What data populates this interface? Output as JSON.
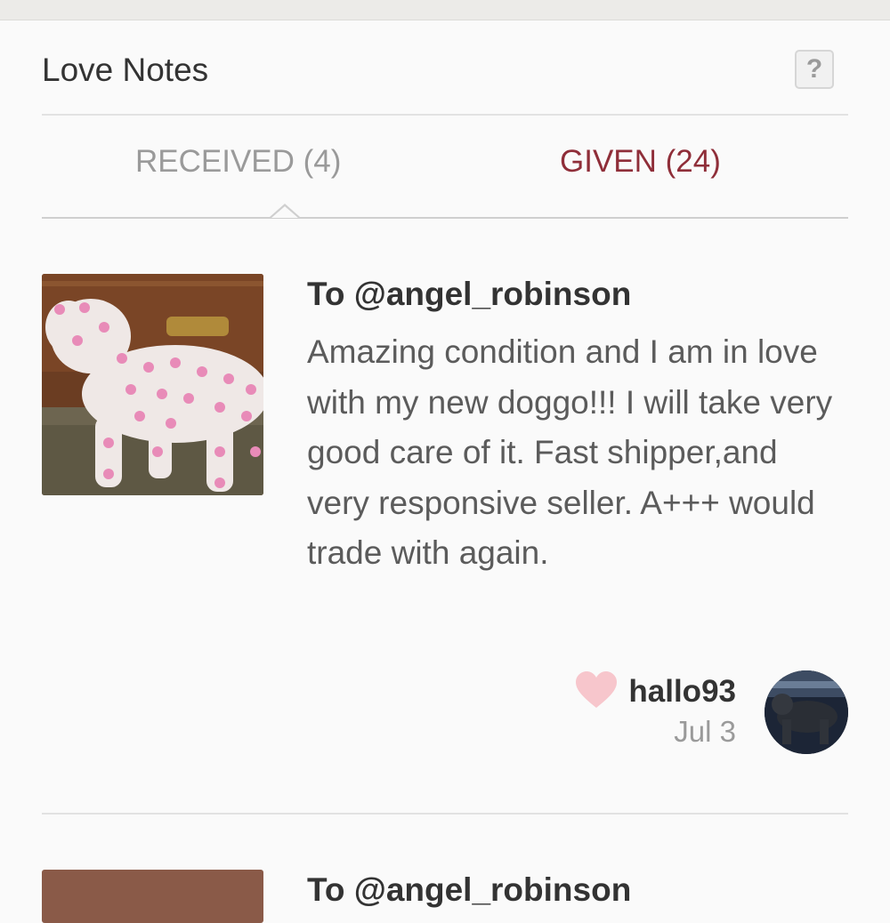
{
  "header": {
    "title": "Love Notes",
    "help_label": "?"
  },
  "tabs": [
    {
      "label": "RECEIVED (4)",
      "active": false
    },
    {
      "label": "GIVEN (24)",
      "active": true
    }
  ],
  "notes": [
    {
      "to": "To @angel_robinson",
      "text": "Amazing condition and I am in love with my new doggo!!! I will take very good care of it. Fast shipper,and very responsive seller. A+++ would trade with again.",
      "author": "hallo93",
      "date": "Jul 3",
      "heart_color": "#f7c6cc"
    },
    {
      "to": "To @angel_robinson"
    }
  ],
  "colors": {
    "accent": "#8f2e39",
    "muted": "#9a9a9a"
  }
}
